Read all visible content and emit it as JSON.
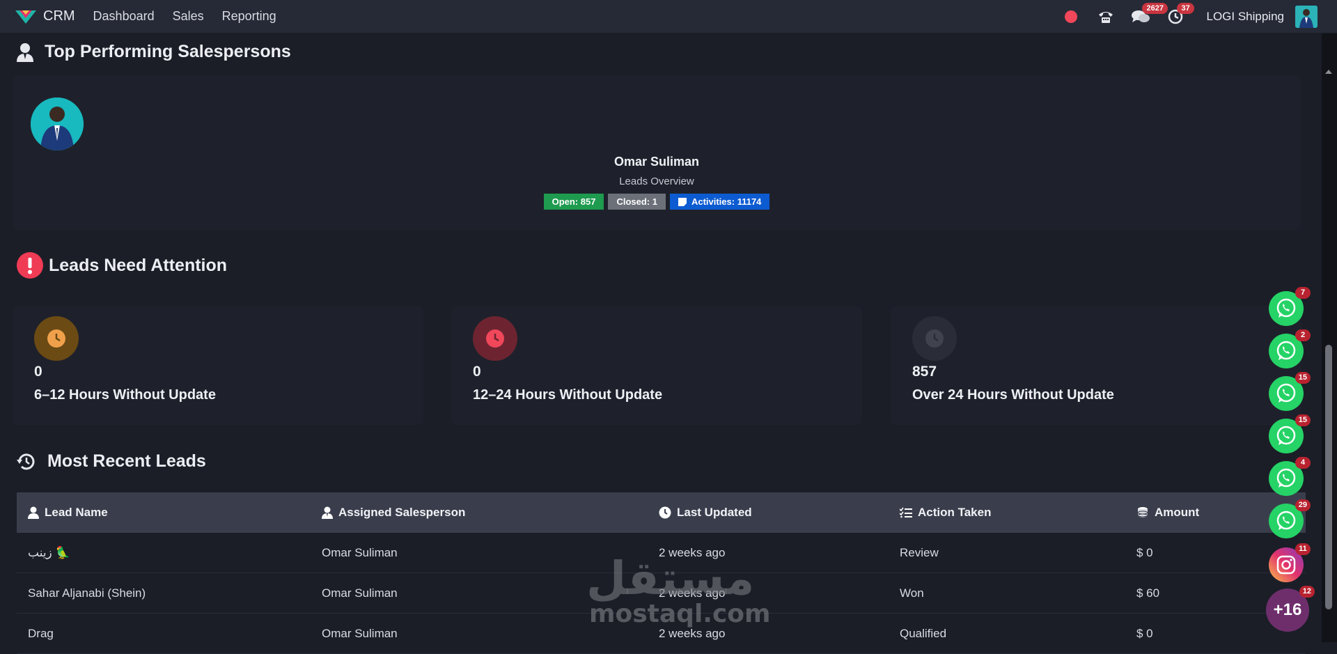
{
  "navbar": {
    "brand": "CRM",
    "links": [
      "Dashboard",
      "Sales",
      "Reporting"
    ],
    "messages_count": "2627",
    "activities_count": "37",
    "company": "LOGI Shipping",
    "icons": [
      "record-indicator",
      "phone-icon",
      "chat-icon",
      "clock-icon"
    ]
  },
  "top_performers": {
    "title": "Top Performing Salespersons",
    "name": "Omar Suliman",
    "subtitle": "Leads Overview",
    "open": "Open: 857",
    "closed": "Closed: 1",
    "activities": "Activities: 11174"
  },
  "attention": {
    "title": "Leads Need Attention",
    "cards": [
      {
        "count": "0",
        "label": "6–12 Hours Without Update",
        "color": "#f0a04b"
      },
      {
        "count": "0",
        "label": "12–24 Hours Without Update",
        "color": "#f0475a"
      },
      {
        "count": "857",
        "label": "Over 24 Hours Without Update",
        "color": "#3a3d47"
      }
    ]
  },
  "recent": {
    "title": "Most Recent Leads",
    "columns": [
      "Lead Name",
      "Assigned Salesperson",
      "Last Updated",
      "Action Taken",
      "Amount"
    ],
    "rows": [
      [
        "زينب 🦜",
        "Omar Suliman",
        "2 weeks ago",
        "Review",
        "$ 0"
      ],
      [
        "Sahar Aljanabi (Shein)",
        "Omar Suliman",
        "2 weeks ago",
        "Won",
        "$ 60"
      ],
      [
        "Drag",
        "Omar Suliman",
        "2 weeks ago",
        "Qualified",
        "$ 0"
      ]
    ]
  },
  "floating": {
    "whatsapp_counts": [
      "7",
      "2",
      "15",
      "15",
      "4",
      "29"
    ],
    "instagram_count": "11",
    "more_label": "+16",
    "more_count": "12"
  },
  "watermark": {
    "arabic": "مستقل",
    "latin": "mostaql.com"
  },
  "colors": {
    "background": "#1b1e27",
    "navbar": "#262a36",
    "open_badge": "#1e9b4f",
    "closed_badge": "#6b7079",
    "activities_badge": "#0d5bd1",
    "alert": "#f0475a",
    "whatsapp": "#25d366"
  }
}
